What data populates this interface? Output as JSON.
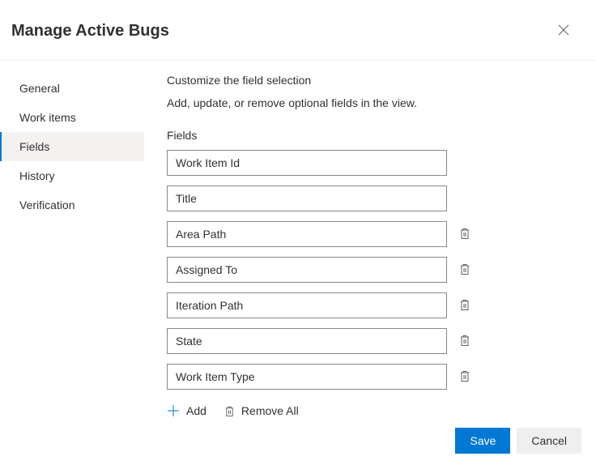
{
  "header": {
    "title": "Manage Active Bugs"
  },
  "sidebar": {
    "items": [
      {
        "label": "General",
        "selected": false
      },
      {
        "label": "Work items",
        "selected": false
      },
      {
        "label": "Fields",
        "selected": true
      },
      {
        "label": "History",
        "selected": false
      },
      {
        "label": "Verification",
        "selected": false
      }
    ]
  },
  "content": {
    "title": "Customize the field selection",
    "subtitle": "Add, update, or remove optional fields in the view.",
    "fields_label": "Fields",
    "fields": [
      {
        "value": "Work Item Id",
        "deletable": false
      },
      {
        "value": "Title",
        "deletable": false
      },
      {
        "value": "Area Path",
        "deletable": true
      },
      {
        "value": "Assigned To",
        "deletable": true
      },
      {
        "value": "Iteration Path",
        "deletable": true
      },
      {
        "value": "State",
        "deletable": true
      },
      {
        "value": "Work Item Type",
        "deletable": true
      }
    ],
    "add_label": "Add",
    "remove_all_label": "Remove All"
  },
  "footer": {
    "save_label": "Save",
    "cancel_label": "Cancel"
  }
}
